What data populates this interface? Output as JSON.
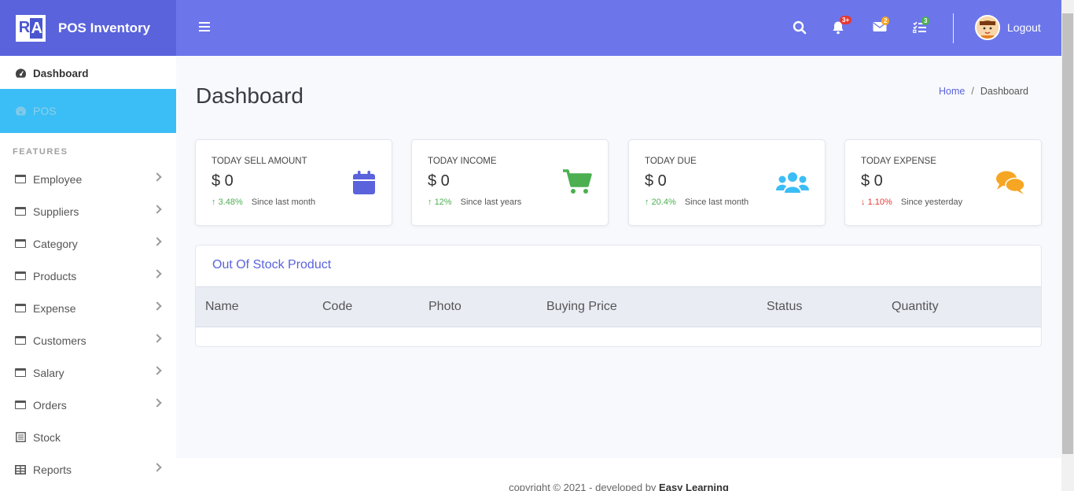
{
  "brand": {
    "logo_text": "RA",
    "name": "POS Inventory"
  },
  "sidebar": {
    "dashboard": "Dashboard",
    "pos": "POS",
    "section_label": "FEATURES",
    "items": [
      {
        "label": "Employee",
        "icon": "window-icon",
        "has_chevron": true
      },
      {
        "label": "Suppliers",
        "icon": "window-icon",
        "has_chevron": true
      },
      {
        "label": "Category",
        "icon": "window-icon",
        "has_chevron": true
      },
      {
        "label": "Products",
        "icon": "window-icon",
        "has_chevron": true
      },
      {
        "label": "Expense",
        "icon": "window-icon",
        "has_chevron": true
      },
      {
        "label": "Customers",
        "icon": "window-icon",
        "has_chevron": true
      },
      {
        "label": "Salary",
        "icon": "window-icon",
        "has_chevron": true
      },
      {
        "label": "Orders",
        "icon": "window-icon",
        "has_chevron": true
      },
      {
        "label": "Stock",
        "icon": "list-icon",
        "has_chevron": false
      },
      {
        "label": "Reports",
        "icon": "table-icon",
        "has_chevron": true
      }
    ]
  },
  "topbar": {
    "alerts_badge": "3+",
    "messages_badge": "2",
    "tasks_badge": "3",
    "logout": "Logout",
    "colors": {
      "bar": "#6c76ea",
      "alerts_badge": "#e53935",
      "messages_badge": "#f6a623",
      "tasks_badge": "#4caf50"
    }
  },
  "page": {
    "title": "Dashboard",
    "breadcrumb": {
      "home": "Home",
      "separator": "/",
      "current": "Dashboard"
    }
  },
  "cards": [
    {
      "title": "TODAY SELL AMOUNT",
      "value": "$ 0",
      "trend": "3.48%",
      "direction": "up",
      "since": "Since last month",
      "icon": "calendar-icon",
      "icon_color": "#5a63db"
    },
    {
      "title": "TODAY INCOME",
      "value": "$ 0",
      "trend": "12%",
      "direction": "up",
      "since": "Since last years",
      "icon": "cart-icon",
      "icon_color": "#4caf50"
    },
    {
      "title": "TODAY DUE",
      "value": "$ 0",
      "trend": "20.4%",
      "direction": "up",
      "since": "Since last month",
      "icon": "users-icon",
      "icon_color": "#3bbdf5"
    },
    {
      "title": "TODAY EXPENSE",
      "value": "$ 0",
      "trend": "1.10%",
      "direction": "down",
      "since": "Since yesterday",
      "icon": "comments-icon",
      "icon_color": "#f6a623"
    }
  ],
  "table": {
    "title": "Out Of Stock Product",
    "columns": [
      "Name",
      "Code",
      "Photo",
      "Buying Price",
      "Status",
      "Quantity"
    ]
  },
  "footer": {
    "prefix": "copyright © 2021 - developed by ",
    "author": "Easy Learning"
  }
}
